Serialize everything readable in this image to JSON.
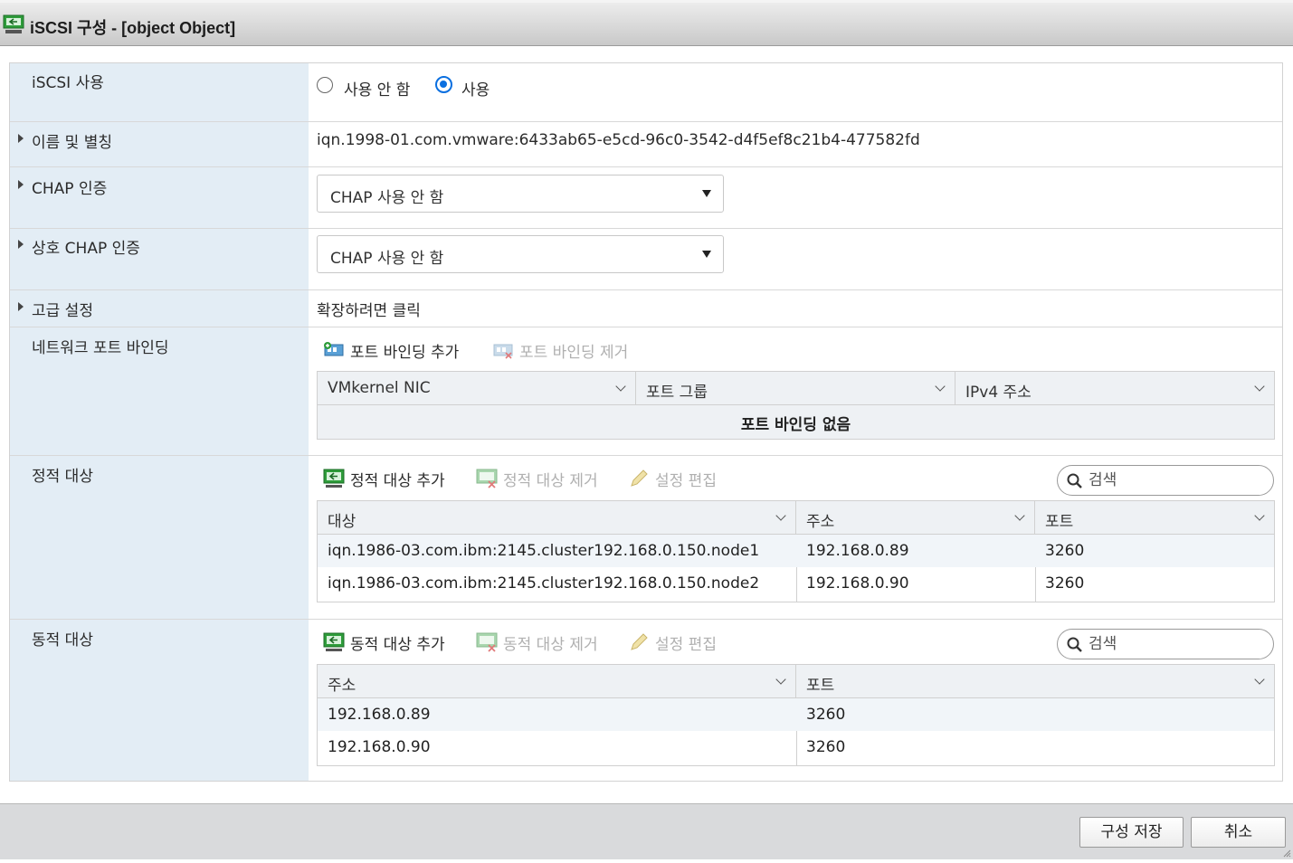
{
  "window": {
    "title": "iSCSI 구성 - [object Object]"
  },
  "enable": {
    "label": "iSCSI 사용",
    "options": [
      "사용 안 함",
      "사용"
    ],
    "selected": "사용"
  },
  "name_alias": {
    "label": "이름 및 별칭",
    "value": "iqn.1998-01.com.vmware:6433ab65-e5cd-96c0-3542-d4f5ef8c21b4-477582fd"
  },
  "chap": {
    "label": "CHAP 인증",
    "value": "CHAP 사용 안 함"
  },
  "mutual_chap": {
    "label": "상호 CHAP 인증",
    "value": "CHAP 사용 안 함"
  },
  "advanced": {
    "label": "고급 설정",
    "value": "확장하려면 클릭"
  },
  "port_binding": {
    "label": "네트워크 포트 바인딩",
    "add_label": "포트 바인딩 추가",
    "remove_label": "포트 바인딩 제거",
    "columns": [
      "VMkernel NIC",
      "포트 그룹",
      "IPv4 주소"
    ],
    "empty_text": "포트 바인딩 없음"
  },
  "static_targets": {
    "label": "정적 대상",
    "add_label": "정적 대상 추가",
    "remove_label": "정적 대상 제거",
    "edit_label": "설정 편집",
    "search_placeholder": "검색",
    "columns": [
      "대상",
      "주소",
      "포트"
    ],
    "rows": [
      {
        "target": "iqn.1986-03.com.ibm:2145.cluster192.168.0.150.node1",
        "address": "192.168.0.89",
        "port": "3260"
      },
      {
        "target": "iqn.1986-03.com.ibm:2145.cluster192.168.0.150.node2",
        "address": "192.168.0.90",
        "port": "3260"
      }
    ]
  },
  "dynamic_targets": {
    "label": "동적 대상",
    "add_label": "동적 대상 추가",
    "remove_label": "동적 대상 제거",
    "edit_label": "설정 편집",
    "search_placeholder": "검색",
    "columns": [
      "주소",
      "포트"
    ],
    "rows": [
      {
        "address": "192.168.0.89",
        "port": "3260"
      },
      {
        "address": "192.168.0.90",
        "port": "3260"
      }
    ]
  },
  "footer": {
    "save_label": "구성 저장",
    "cancel_label": "취소"
  },
  "colors": {
    "accent": "#0a6fe0",
    "label_bg": "#e3edf5",
    "icon_green": "#2e9c3a"
  }
}
